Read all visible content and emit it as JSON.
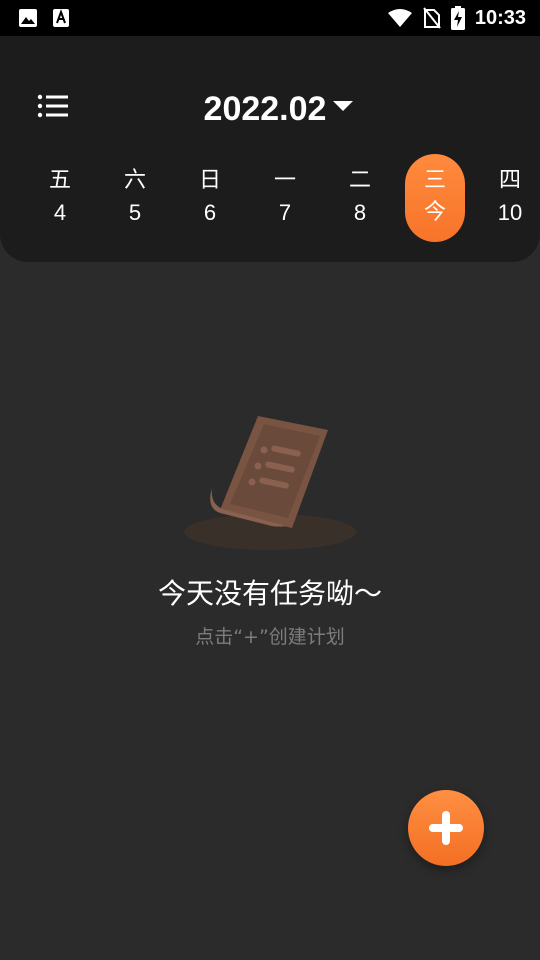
{
  "status_bar": {
    "time": "10:33",
    "left_icons": [
      "image-icon",
      "text-a-icon"
    ],
    "right_icons": [
      "wifi-icon",
      "no-sim-icon",
      "battery-charging-icon"
    ]
  },
  "header": {
    "menu_icon": "list-menu-icon",
    "month": "2022.02",
    "dropdown_icon": "caret-down-icon",
    "days": [
      {
        "weekday": "五",
        "day": "4"
      },
      {
        "weekday": "六",
        "day": "5"
      },
      {
        "weekday": "日",
        "day": "6"
      },
      {
        "weekday": "一",
        "day": "7"
      },
      {
        "weekday": "二",
        "day": "8"
      },
      {
        "weekday": "三",
        "day": "今",
        "active": true
      },
      {
        "weekday": "四",
        "day": "10"
      }
    ]
  },
  "empty_state": {
    "illustration": "document-list-icon",
    "title": "今天没有任务呦～",
    "hint": "点击“+”创建计划"
  },
  "fab": {
    "icon": "plus-icon"
  },
  "colors": {
    "accent": "#f7742a",
    "background": "#2b2b2b",
    "header_bg": "#1c1c1c",
    "hint_text": "#7c7c7c"
  }
}
